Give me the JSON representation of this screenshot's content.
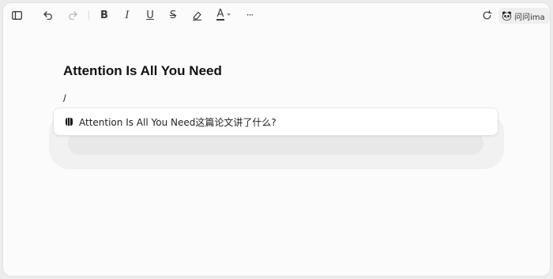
{
  "toolbar": {
    "underline_glyph": "U",
    "bold_glyph": "B",
    "italic_glyph": "I",
    "strike_glyph": "S",
    "color_glyph": "A",
    "more_glyph": "···",
    "ask_ima_label": "问问ima"
  },
  "document": {
    "title": "Attention Is All You Need",
    "slash_command": "/"
  },
  "suggestion": {
    "text": "Attention Is All You Need这篇论文讲了什么?",
    "icon": "ima-logo-icon"
  },
  "colors": {
    "background": "#fbfbfb",
    "text": "#111111",
    "disabled": "#b9b9b9"
  }
}
